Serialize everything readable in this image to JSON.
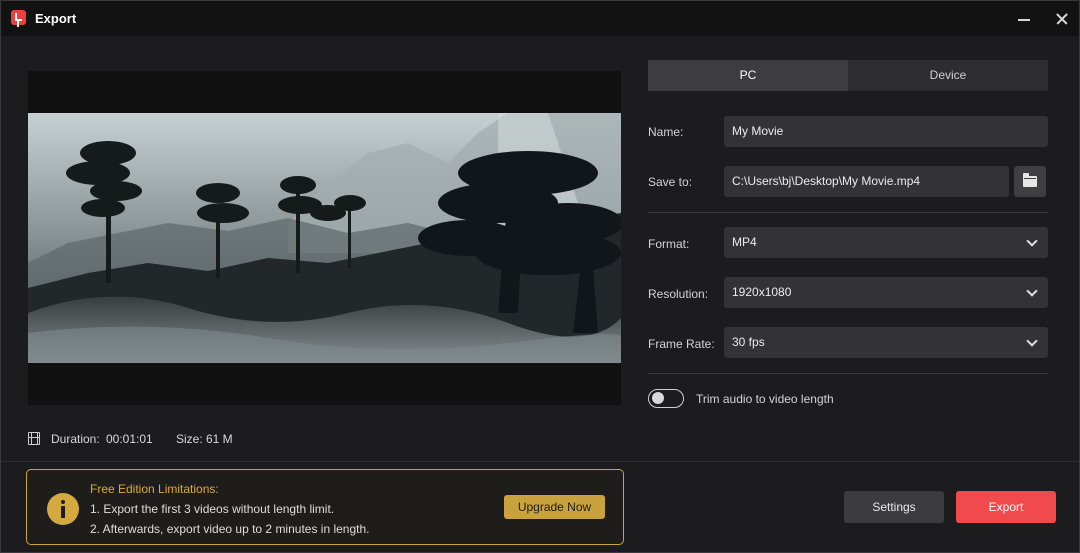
{
  "window": {
    "title": "Export"
  },
  "preview": {
    "duration_label": "Duration:",
    "duration_value": "00:01:01",
    "size_label": "Size:",
    "size_value": "61 M"
  },
  "tabs": [
    {
      "label": "PC",
      "selected": true
    },
    {
      "label": "Device",
      "selected": false
    }
  ],
  "fields": {
    "name": {
      "label": "Name:",
      "value": "My Movie"
    },
    "save_to": {
      "label": "Save to:",
      "value": "C:\\Users\\bj\\Desktop\\My Movie.mp4"
    },
    "format": {
      "label": "Format:",
      "value": "MP4"
    },
    "resolution": {
      "label": "Resolution:",
      "value": "1920x1080"
    },
    "frame_rate": {
      "label": "Frame Rate:",
      "value": "30 fps"
    }
  },
  "trim_audio": {
    "label": "Trim audio to video length",
    "enabled": false
  },
  "limitations": {
    "title": "Free Edition Limitations:",
    "line1": "1. Export the first 3 videos without length limit.",
    "line2": "2. Afterwards, export video up to 2 minutes in length.",
    "upgrade_label": "Upgrade Now"
  },
  "actions": {
    "settings_label": "Settings",
    "export_label": "Export"
  },
  "colors": {
    "accent": "#f04a4c",
    "warning": "#caa23d",
    "background": "#1c1c1e"
  },
  "icons": [
    "app-logo-icon",
    "minimize-icon",
    "close-icon",
    "film-icon",
    "folder-icon",
    "chevron-down-icon",
    "info-icon"
  ]
}
